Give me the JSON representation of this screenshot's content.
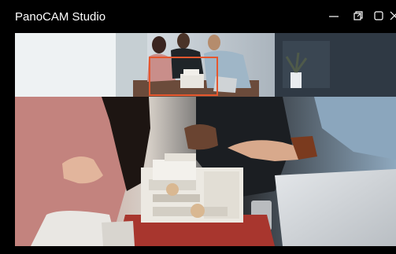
{
  "window": {
    "title": "PanoCAM Studio"
  },
  "title_controls": {
    "minimize_icon": "minimize-icon",
    "restore_icon": "restore-icon",
    "maximize_icon": "maximize-icon",
    "close_icon": "close-icon"
  },
  "overview": {
    "roi_color": "#e5572e"
  },
  "colors": {
    "titlebar_bg": "#000000",
    "title_text": "#ffffff",
    "accent": "#e5572e"
  }
}
